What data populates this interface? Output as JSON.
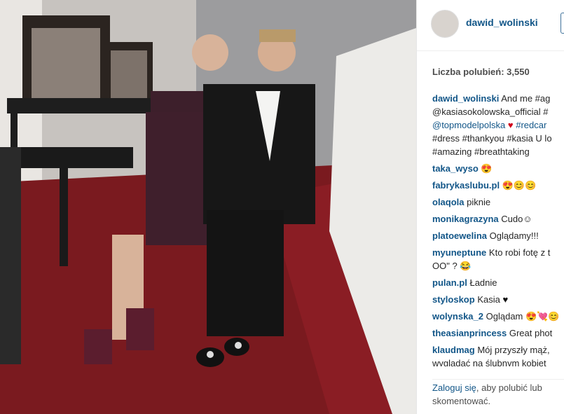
{
  "post": {
    "username": "dawid_wolinski",
    "likes_text": "Liczba polubień: 3,550"
  },
  "caption": {
    "user": "dawid_wolinski",
    "lines": [
      "And me #ag",
      "@kasiasokolowska_official #",
      "@topmodelpolska",
      "#redcar",
      "#dress #thankyou #kasia U lo",
      "#amazing #breathtaking"
    ]
  },
  "comments": [
    {
      "user": "taka_wyso",
      "text": "😍"
    },
    {
      "user": "fabrykaslubu.pl",
      "text": "😍😊😊"
    },
    {
      "user": "olaqola",
      "text": "piknie"
    },
    {
      "user": "monikagrazyna",
      "text": "Cudo☺"
    },
    {
      "user": "platoewelina",
      "text": "Oglądamy!!!"
    },
    {
      "user": "myuneptune",
      "text": "Kto robi fotę z t",
      "text2": "OO\" ? 😂"
    },
    {
      "user": "pulan.pl",
      "text": "Ładnie"
    },
    {
      "user": "styloskop",
      "text": "Kasia"
    },
    {
      "user": "wolynska_2",
      "text": "Oglądam 😍💘😊"
    },
    {
      "user": "theasianprincess",
      "text": "Great phot"
    },
    {
      "user": "klaudmag",
      "text": "Mój przyszły mąż,",
      "text2": "wyglądać na ślubnym kobiet"
    }
  ],
  "login": {
    "link": "Zaloguj się",
    "rest": ", aby polubić lub",
    "line2": "skomentować."
  }
}
